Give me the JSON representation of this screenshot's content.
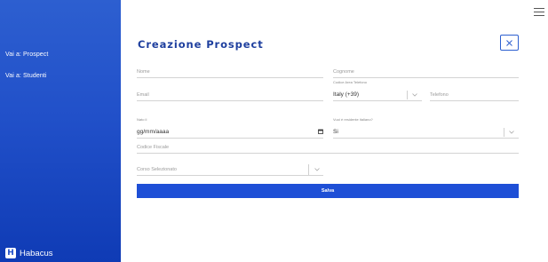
{
  "sidebar": {
    "links": [
      {
        "label": "Vai a: Prospect"
      },
      {
        "label": "Vai a: Studenti"
      }
    ],
    "brand": {
      "mark": "H",
      "name": "Habacus"
    }
  },
  "header": {
    "menu_icon": "hamburger-menu-icon"
  },
  "form": {
    "title": "Creazione Prospect",
    "close_icon": "close-icon",
    "nome": {
      "placeholder": "Nome"
    },
    "cognome": {
      "placeholder": "Cognome"
    },
    "email": {
      "placeholder": "Email"
    },
    "prefix": {
      "label": "Codice Area Telefono",
      "value": "Italy (+39)"
    },
    "telefono": {
      "placeholder": "Telefono"
    },
    "birth": {
      "label": "Nato il",
      "value": "gg/mm/aaaa",
      "icon": "calendar-icon"
    },
    "residente": {
      "label": "Vuoi è residente italiano?",
      "value": "Si"
    },
    "codice_fiscale": {
      "placeholder": "Codice Fiscale"
    },
    "corso": {
      "placeholder": "Corso Selezionato"
    },
    "save_label": "Salva"
  },
  "colors": {
    "sidebar": "#2150c9",
    "accent": "#1e4fd6",
    "title": "#1e3f9e"
  }
}
